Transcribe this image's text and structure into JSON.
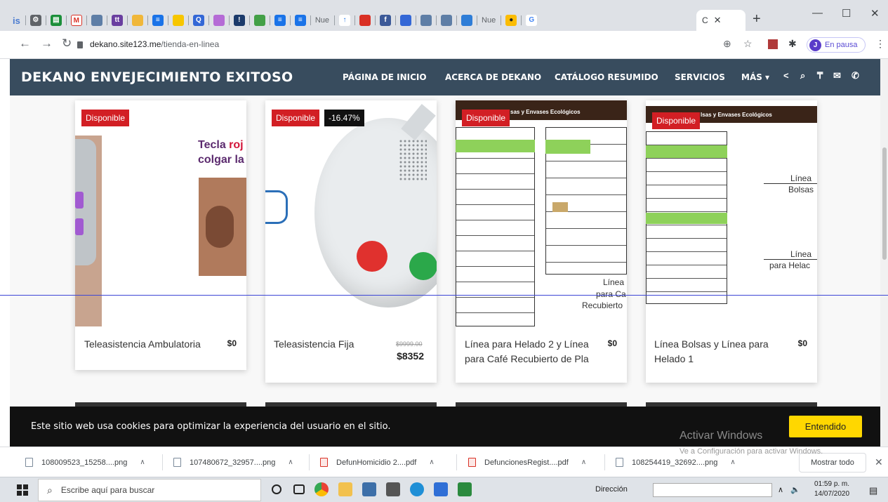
{
  "browser": {
    "tab_labels": [
      "is",
      "Nue",
      "Nue"
    ],
    "active_tab_label": "C",
    "url_host": "dekano.site123.me",
    "url_path": "/tienda-en-linea",
    "profile_initial": "J",
    "profile_status": "En pausa"
  },
  "site": {
    "brand": "DEKANO ENVEJECIMIENTO EXITOSO",
    "menu": [
      "PÁGINA DE INICIO",
      "ACERCA DE DEKANO",
      "CATÁLOGO RESUMIDO",
      "SERVICIOS",
      "MÁS"
    ]
  },
  "products": [
    {
      "badge": "Disponible",
      "title": "Teleasistencia Ambulatoria",
      "price": "$0",
      "image_text": [
        "Tecla ",
        "roj",
        "colgar la"
      ]
    },
    {
      "badge": "Disponible",
      "discount": "-16.47%",
      "title": "Teleasistencia Fija",
      "old_price": "$9999.00",
      "price": "$8352"
    },
    {
      "badge": "Disponible",
      "title_line1": "Línea para Helado 2 y Línea",
      "title_line2": "para Café Recubierto de Pla",
      "price": "$0",
      "image_header": "sas y Envases Ecológicos",
      "image_labels": [
        "Línea",
        "para Ca",
        "Recubierto"
      ]
    },
    {
      "badge": "Disponible",
      "title_line1": "Línea Bolsas y Línea para",
      "title_line2": "Helado 1",
      "price": "$0",
      "image_header": "lsas y Envases Ecológicos",
      "image_labels_a": [
        "Línea",
        "Bolsas"
      ],
      "image_labels_b": [
        "Línea",
        "para Helac"
      ]
    }
  ],
  "cookie": {
    "text": "Este sitio web usa cookies para optimizar la experiencia del usuario en el sitio.",
    "button": "Entendido"
  },
  "watermark": {
    "line1": "Activar Windows",
    "line2": "Ve a Configuración para activar Windows."
  },
  "downloads": {
    "items": [
      "108009523_15258....png",
      "107480672_32957....png",
      "DefunHomicidio 2....pdf",
      "DefuncionesRegist....pdf",
      "108254419_32692....png"
    ],
    "show_all": "Mostrar todo"
  },
  "taskbar": {
    "search_placeholder": "Escribe aquí para buscar",
    "address_label": "Dirección",
    "time": "01:59 p. m.",
    "date": "14/07/2020"
  }
}
